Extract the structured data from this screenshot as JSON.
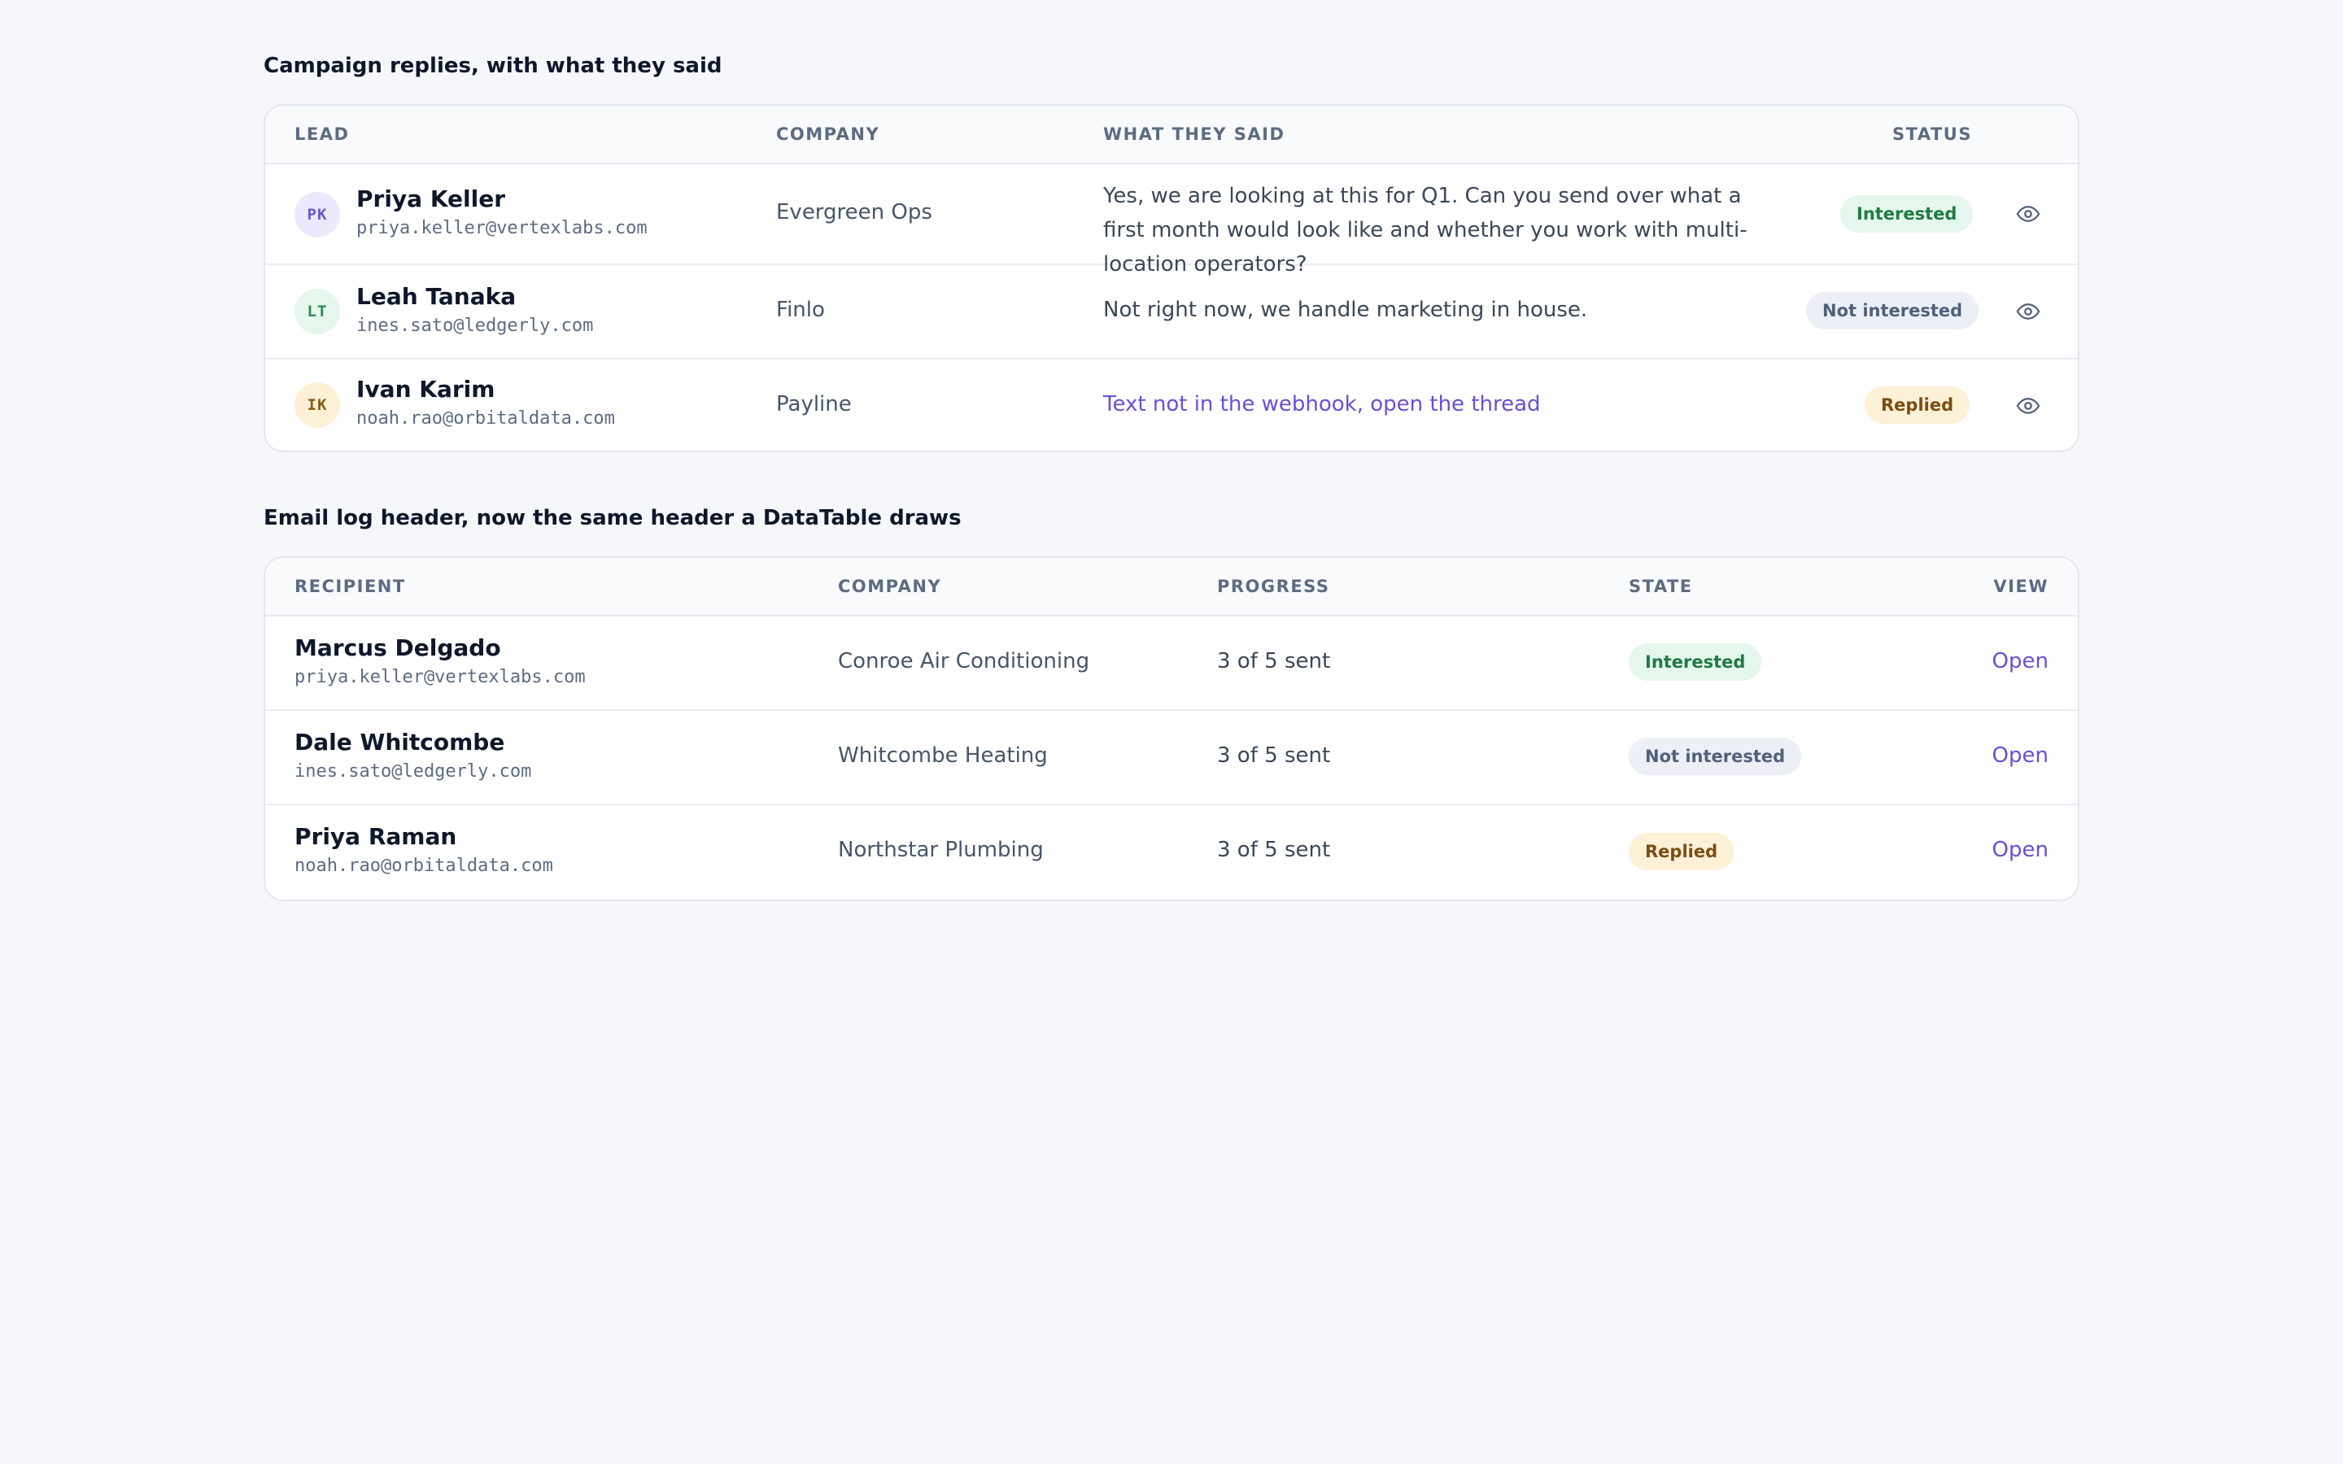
{
  "replies": {
    "title": "Campaign replies, with what they said",
    "headers": {
      "lead": "LEAD",
      "company": "COMPANY",
      "said": "WHAT THEY SAID",
      "status": "STATUS"
    },
    "rows": [
      {
        "initials": "PK",
        "name": "Priya Keller",
        "email": "priya.keller@vertexlabs.com",
        "company": "Evergreen Ops",
        "said": "Yes, we are looking at this for Q1. Can you send over what a first month would look like and whether you work with multi-location operators?",
        "status": "Interested",
        "view_icon": "eye-icon"
      },
      {
        "initials": "LT",
        "name": "Leah Tanaka",
        "email": "ines.sato@ledgerly.com",
        "company": "Finlo",
        "said": "Not right now, we handle marketing in house.",
        "status": "Not interested",
        "view_icon": "eye-icon"
      },
      {
        "initials": "IK",
        "name": "Ivan Karim",
        "email": "noah.rao@orbitaldata.com",
        "company": "Payline",
        "said": "Text not in the webhook, open the thread",
        "status": "Replied",
        "view_icon": "eye-icon"
      }
    ]
  },
  "emaillog": {
    "title": "Email log header, now the same header a DataTable draws",
    "headers": {
      "recipient": "RECIPIENT",
      "company": "COMPANY",
      "progress": "PROGRESS",
      "state": "STATE",
      "view": "VIEW"
    },
    "rows": [
      {
        "name": "Marcus Delgado",
        "email": "priya.keller@vertexlabs.com",
        "company": "Conroe Air Conditioning",
        "progress": "3 of 5 sent",
        "state": "Interested",
        "view": "Open"
      },
      {
        "name": "Dale Whitcombe",
        "email": "ines.sato@ledgerly.com",
        "company": "Whitcombe Heating",
        "progress": "3 of 5 sent",
        "state": "Not interested",
        "view": "Open"
      },
      {
        "name": "Priya Raman",
        "email": "noah.rao@orbitaldata.com",
        "company": "Northstar Plumbing",
        "progress": "3 of 5 sent",
        "state": "Replied",
        "view": "Open"
      }
    ]
  },
  "colors": {
    "accent": "#6a4fd6",
    "interested_bg": "#e5f6ec",
    "interested_fg": "#1f7a44",
    "not_interested_bg": "#eceff6",
    "not_interested_fg": "#52607a",
    "replied_bg": "#fcf0d7",
    "replied_fg": "#7a4e12"
  }
}
